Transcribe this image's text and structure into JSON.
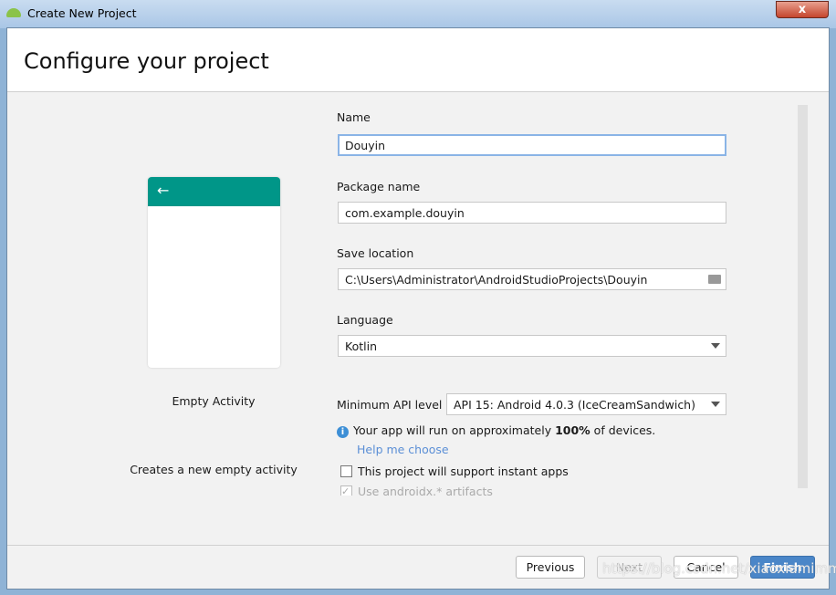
{
  "window": {
    "title": "Create New Project",
    "close": "x"
  },
  "header": {
    "title": "Configure your project"
  },
  "template": {
    "name": "Empty Activity",
    "description": "Creates a new empty activity",
    "back_icon": "←"
  },
  "form": {
    "name_label": "Name",
    "name_value": "Douyin",
    "package_label": "Package name",
    "package_value": "com.example.douyin",
    "save_label": "Save location",
    "save_value": "C:\\Users\\Administrator\\AndroidStudioProjects\\Douyin",
    "language_label": "Language",
    "language_value": "Kotlin",
    "api_label": "Minimum API level",
    "api_value": "API 15: Android 4.0.3 (IceCreamSandwich)",
    "info_prefix": "Your app will run on approximately ",
    "info_bold": "100%",
    "info_suffix": " of devices.",
    "help_link": "Help me choose",
    "instant_label": "This project will support instant apps",
    "instant_checked": false,
    "androidx_label": "Use androidx.* artifacts",
    "androidx_checked": true
  },
  "buttons": {
    "previous": "Previous",
    "next": "Next",
    "cancel": "Cancel",
    "finish": "Finish"
  },
  "watermark": "https://blog.csdn.net/xiaoxiamimm",
  "colors": {
    "accent": "#009688",
    "primary_button": "#4a86c8",
    "link": "#5b8fd6"
  }
}
